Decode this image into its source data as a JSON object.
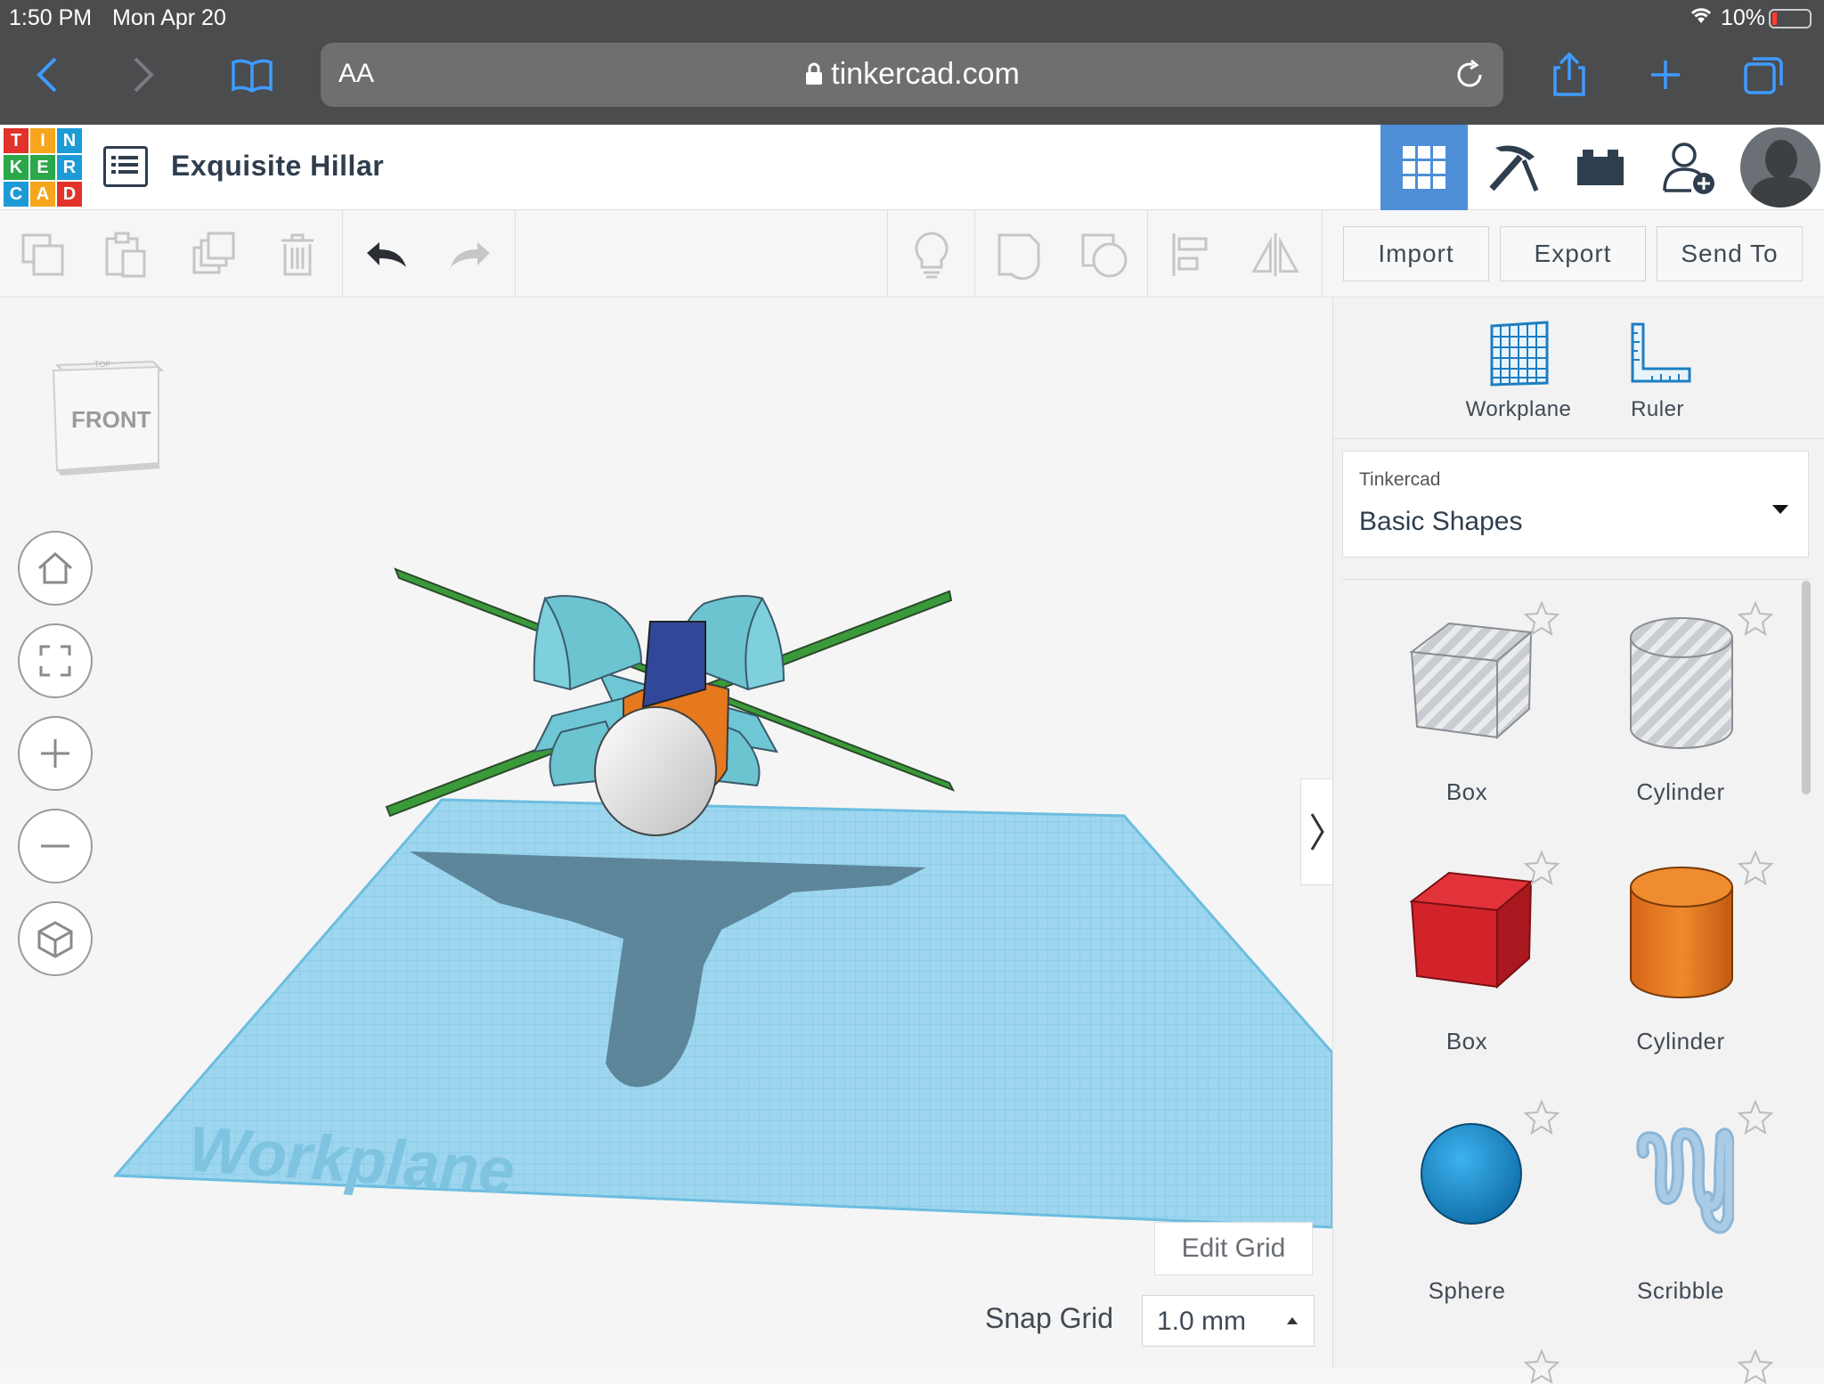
{
  "status_bar": {
    "time": "1:50 PM",
    "date": "Mon Apr 20",
    "battery": "10%"
  },
  "browser": {
    "aa_label": "AA",
    "url": "tinkercad.com"
  },
  "app": {
    "logo_letters": [
      "T",
      "I",
      "N",
      "K",
      "E",
      "R",
      "C",
      "A",
      "D"
    ],
    "logo_colors": [
      "#e2322a",
      "#f6a51c",
      "#1d9bd7",
      "#2aa84a",
      "#2aa84a",
      "#1d9bd7",
      "#1d9bd7",
      "#f6a51c",
      "#e2322a"
    ],
    "design_title": "Exquisite Hillar",
    "header_buttons": [
      "3d-design-icon",
      "codeblocks-pickaxe-icon",
      "bricks-icon",
      "add-user-icon",
      "user-avatar"
    ]
  },
  "toolbar": {
    "import_label": "Import",
    "export_label": "Export",
    "send_to_label": "Send To"
  },
  "viewport": {
    "view_cube_label": "FRONT",
    "view_cube_top_label": "TOP",
    "workplane_watermark": "Workplane",
    "edit_grid_label": "Edit Grid",
    "snap_grid_label": "Snap Grid",
    "snap_grid_value": "1.0 mm"
  },
  "panel": {
    "workplane_label": "Workplane",
    "ruler_label": "Ruler",
    "library_provider": "Tinkercad",
    "library_name": "Basic Shapes",
    "shapes": [
      {
        "label": "Box"
      },
      {
        "label": "Cylinder"
      },
      {
        "label": "Box"
      },
      {
        "label": "Cylinder"
      },
      {
        "label": "Sphere"
      },
      {
        "label": "Scribble"
      }
    ]
  },
  "colors": {
    "accent_blue": "#3f9bff",
    "header_active": "#4e8fd8",
    "workplane": "#8fd0ea",
    "box_red": "#d2232a",
    "cylinder_orange": "#e6781e",
    "sphere_blue": "#1a8fd0"
  }
}
